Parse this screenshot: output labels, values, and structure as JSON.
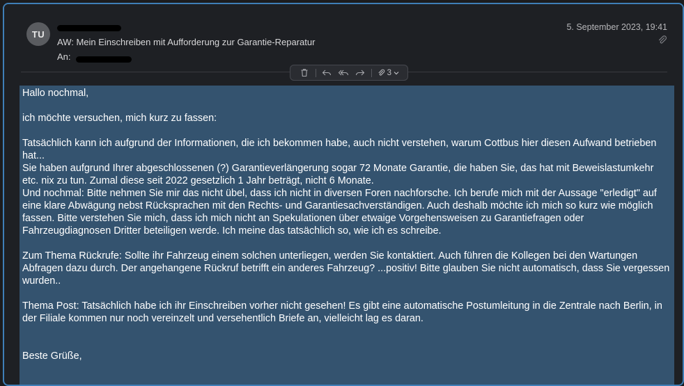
{
  "email": {
    "avatar_initials": "TU",
    "subject": "AW: Mein Einschreiben mit Aufforderung zur Garantie-Reparatur",
    "to_label": "An:",
    "date": "5. September 2023, 19:41"
  },
  "toolbar": {
    "attachment_count": "3"
  },
  "body": {
    "greeting": "Hallo nochmal,",
    "intro": "ich möchte versuchen, mich kurz zu fassen:",
    "para1": [
      "Tatsächlich kann ich aufgrund der Informationen, die ich bekommen habe, auch nicht verstehen, warum Cottbus hier diesen Aufwand betrieben hat...",
      "Sie haben aufgrund Ihrer abgeschlossenen (?) Garantieverlängerung sogar 72 Monate Garantie, die haben Sie, das hat mit Beweislastumkehr etc. nix zu tun. Zumal diese seit 2022 gesetzlich 1 Jahr beträgt, nicht 6 Monate.",
      "Und nochmal: Bitte nehmen Sie mir das nicht übel, dass ich nicht in diversen Foren nachforsche. Ich berufe mich mit der Aussage \"erledigt\" auf eine klare Abwägung nebst Rücksprachen mit den Rechts- und Garantiesachverständigen. Auch deshalb möchte ich mich so kurz wie möglich fassen. Bitte verstehen Sie mich, dass ich mich nicht an Spekulationen über etwaige Vorgehensweisen zu Garantiefragen oder Fahrzeugdiagnosen Dritter beteiligen werde. Ich meine das tatsächlich so, wie ich es schreibe."
    ],
    "para2": "Zum Thema Rückrufe: Sollte ihr Fahrzeug einem solchen unterliegen, werden Sie kontaktiert. Auch führen die Kollegen bei den Wartungen Abfragen dazu durch. Der angehangene Rückruf betrifft ein anderes Fahrzeug? ...positiv! Bitte glauben Sie nicht automatisch, dass Sie vergessen wurden..",
    "para3": "Thema Post: Tatsächlich habe ich ihr Einschreiben vorher nicht gesehen! Es gibt eine automatische Postumleitung in die Zentrale nach Berlin, in der Filiale kommen nur noch vereinzelt und versehentlich Briefe an, vielleicht lag es daran.",
    "closing": "Beste Grüße,"
  },
  "colors": {
    "selection": "#34536f",
    "window_border": "#3f7fb8",
    "background": "#1e2024"
  }
}
